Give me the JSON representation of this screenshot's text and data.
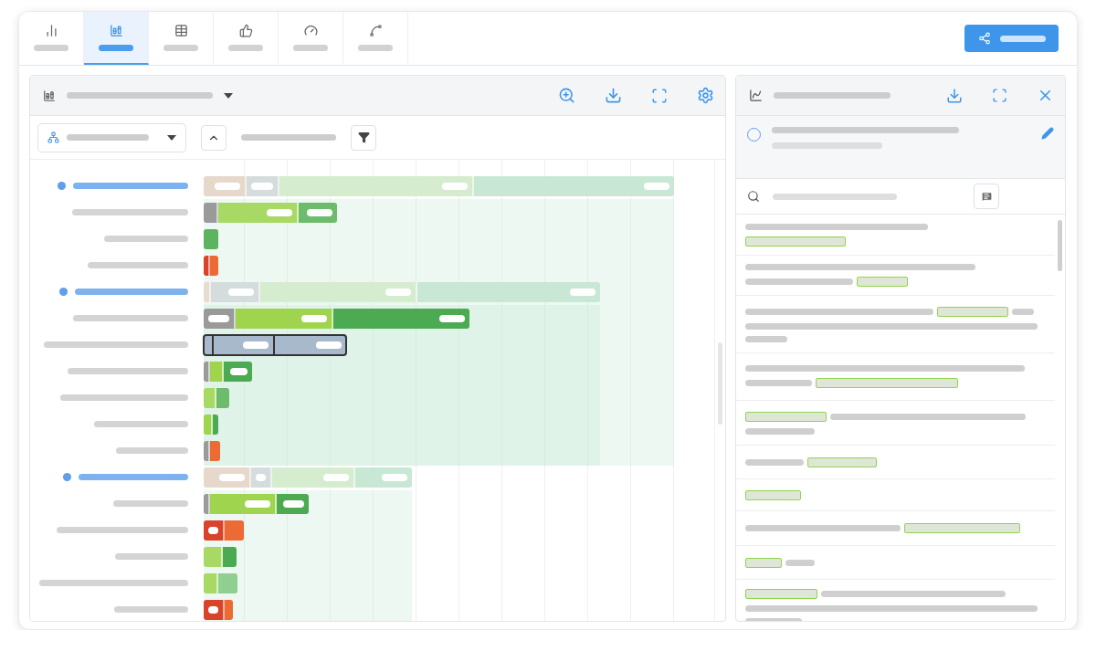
{
  "tabs": [
    {
      "kind": "bars",
      "selected": false
    },
    {
      "kind": "stacked",
      "selected": true
    },
    {
      "kind": "table",
      "selected": false
    },
    {
      "kind": "thumbs",
      "selected": false
    },
    {
      "kind": "gauge",
      "selected": false
    },
    {
      "kind": "trend",
      "selected": false
    }
  ],
  "tree": [
    {
      "kind": "group",
      "selected": false,
      "segments": [
        {
          "color": "#e6d8cb"
        },
        {
          "color": "#d5dcdd"
        },
        {
          "color": "#d5ecce"
        },
        {
          "color": "#c8e7d5"
        }
      ],
      "children": [
        {
          "kind": "item",
          "selected": false,
          "segments": [
            {
              "color": "#9a9a9a"
            },
            {
              "color": "#a8d964"
            },
            {
              "color": "#6cbc6c"
            }
          ]
        },
        {
          "kind": "item",
          "selected": false,
          "segments": [
            {
              "color": "#5cb360"
            }
          ]
        },
        {
          "kind": "item",
          "selected": false,
          "segments": [
            {
              "color": "#d8432a"
            },
            {
              "color": "#ec6b35"
            }
          ]
        },
        {
          "kind": "group",
          "selected": false,
          "segments": [
            {
              "color": "#e6dcd0"
            },
            {
              "color": "#d5dcdd"
            },
            {
              "color": "#d5ecce"
            },
            {
              "color": "#c8e7d5"
            }
          ],
          "children": [
            {
              "kind": "item",
              "selected": false,
              "segments": [
                {
                  "color": "#9a9a9a"
                },
                {
                  "color": "#9ed44e"
                },
                {
                  "color": "#4caa52"
                }
              ]
            },
            {
              "kind": "item",
              "selected": true,
              "segments": [
                {
                  "color": "#a9b9cc"
                },
                {
                  "color": "#a9b9cc"
                },
                {
                  "color": "#a9b9cc"
                }
              ]
            },
            {
              "kind": "item",
              "selected": false,
              "segments": [
                {
                  "color": "#9a9a9a"
                },
                {
                  "color": "#9ed44e"
                },
                {
                  "color": "#4caa52"
                }
              ]
            },
            {
              "kind": "item",
              "selected": false,
              "segments": [
                {
                  "color": "#a8d964"
                },
                {
                  "color": "#6cbc6c"
                }
              ]
            },
            {
              "kind": "item",
              "selected": false,
              "segments": [
                {
                  "color": "#9ed44e"
                },
                {
                  "color": "#4caa52"
                }
              ]
            },
            {
              "kind": "item",
              "selected": false,
              "segments": [
                {
                  "color": "#9a9a9a"
                },
                {
                  "color": "#ec6b35"
                }
              ]
            }
          ]
        }
      ]
    },
    {
      "kind": "group",
      "selected": false,
      "segments": [
        {
          "color": "#e6d8cb"
        },
        {
          "color": "#d5dcdd"
        },
        {
          "color": "#d5ecce"
        },
        {
          "color": "#c8e7d5"
        }
      ],
      "children": [
        {
          "kind": "item",
          "selected": false,
          "segments": [
            {
              "color": "#9a9a9a"
            },
            {
              "color": "#9ed44e"
            },
            {
              "color": "#4caa52"
            }
          ]
        },
        {
          "kind": "item",
          "selected": false,
          "segments": [
            {
              "color": "#d8432a"
            },
            {
              "color": "#ec6b35"
            }
          ]
        },
        {
          "kind": "item",
          "selected": false,
          "segments": [
            {
              "color": "#a8d964"
            },
            {
              "color": "#4caa52"
            }
          ]
        },
        {
          "kind": "item",
          "selected": false,
          "segments": [
            {
              "color": "#a8d964"
            },
            {
              "color": "#8fcf8f"
            }
          ]
        },
        {
          "kind": "item",
          "selected": false,
          "segments": [
            {
              "color": "#d8432a"
            },
            {
              "color": "#ec6b35"
            }
          ]
        }
      ]
    }
  ]
}
